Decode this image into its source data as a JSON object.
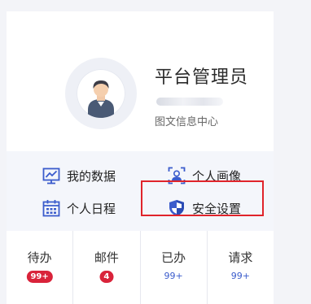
{
  "profile": {
    "name": "平台管理员",
    "department": "图文信息中心"
  },
  "menu": {
    "my_data": "我的数据",
    "personal_portrait": "个人画像",
    "personal_schedule": "个人日程",
    "security_settings": "安全设置"
  },
  "stats": {
    "todo": {
      "label": "待办",
      "count": "99+"
    },
    "mail": {
      "label": "邮件",
      "count": "4"
    },
    "done": {
      "label": "已办",
      "count": "99+"
    },
    "request": {
      "label": "请求",
      "count": "99+"
    }
  },
  "colors": {
    "accent": "#3b5ccc",
    "badge": "#d9233a",
    "highlight": "#e0242b"
  },
  "icons": [
    "avatar-person",
    "chart-monitor-icon",
    "portrait-frame-icon",
    "calendar-icon",
    "shield-icon"
  ]
}
